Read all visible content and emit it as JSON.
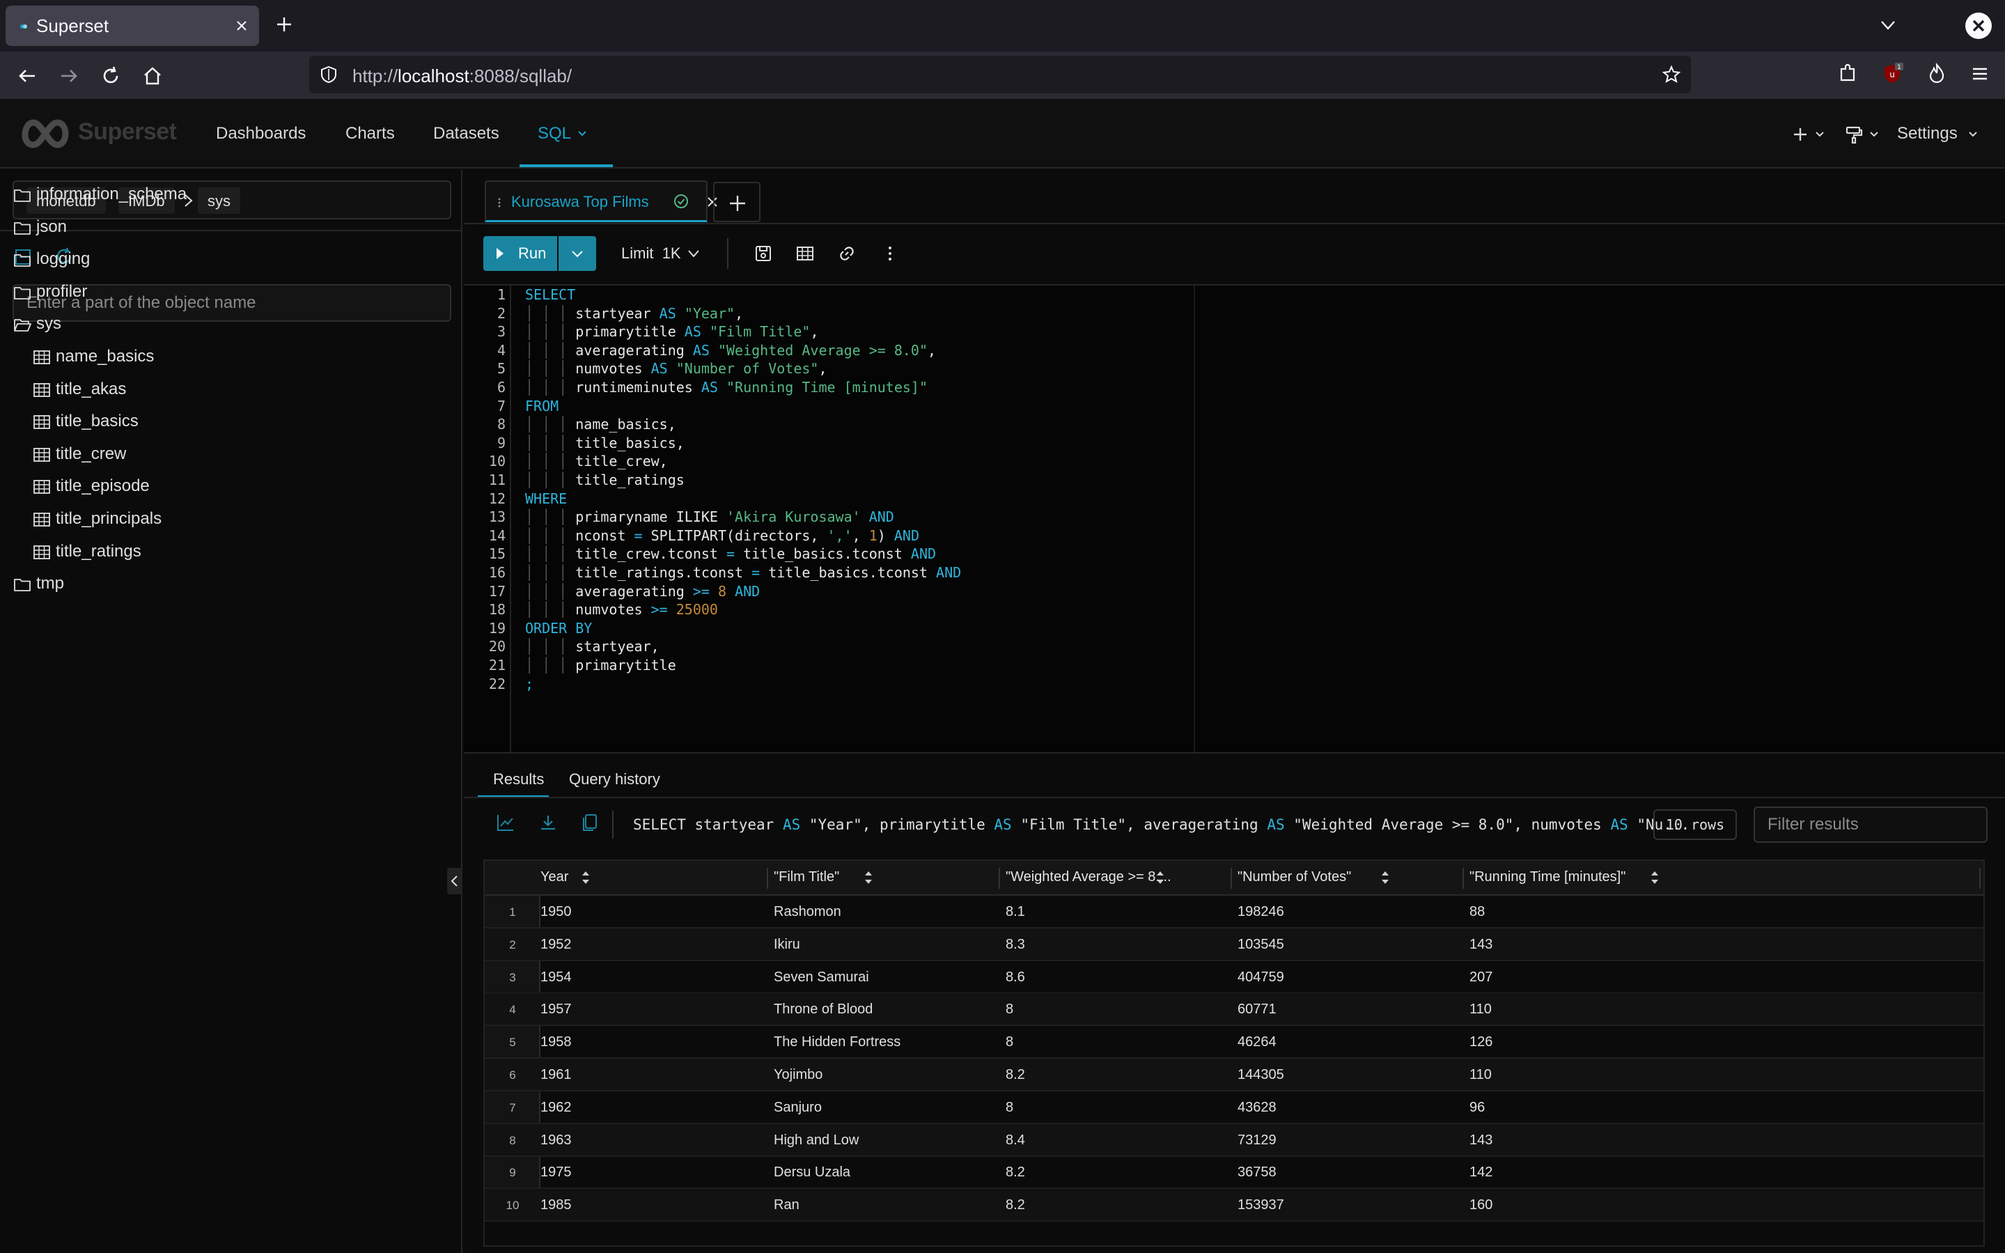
{
  "browser": {
    "tab_title": "Superset",
    "url_prefix": "http://",
    "url_host": "localhost",
    "url_rest": ":8088/sqllab/",
    "extension_badge": "1"
  },
  "header": {
    "logo": "Superset",
    "menu": [
      "Dashboards",
      "Charts",
      "Datasets",
      "SQL"
    ],
    "settings_label": "Settings"
  },
  "sidebar": {
    "database": "monetdb",
    "catalog": "IMDb",
    "schema": "sys",
    "search_placeholder": "Enter a part of the object name",
    "schemas": [
      {
        "name": "information_schema",
        "open": false
      },
      {
        "name": "json",
        "open": false
      },
      {
        "name": "logging",
        "open": false
      },
      {
        "name": "profiler",
        "open": false
      },
      {
        "name": "sys",
        "open": true
      }
    ],
    "tables": [
      "name_basics",
      "title_akas",
      "title_basics",
      "title_crew",
      "title_episode",
      "title_principals",
      "title_ratings"
    ],
    "after_schemas": [
      {
        "name": "tmp",
        "open": false
      }
    ]
  },
  "editor": {
    "tab_label": "Kurosawa Top Films",
    "run_label": "Run",
    "limit_label": "Limit",
    "limit_value": "1K",
    "lines": [
      [
        [
          "kw",
          "SELECT"
        ]
      ],
      [
        [
          "ind",
          ""
        ],
        [
          "t",
          "startyear "
        ],
        [
          "kw",
          "AS"
        ],
        [
          "t",
          " "
        ],
        [
          "str",
          "\"Year\""
        ],
        [
          "t",
          ","
        ]
      ],
      [
        [
          "ind",
          ""
        ],
        [
          "t",
          "primarytitle "
        ],
        [
          "kw",
          "AS"
        ],
        [
          "t",
          " "
        ],
        [
          "str",
          "\"Film Title\""
        ],
        [
          "t",
          ","
        ]
      ],
      [
        [
          "ind",
          ""
        ],
        [
          "t",
          "averagerating "
        ],
        [
          "kw",
          "AS"
        ],
        [
          "t",
          " "
        ],
        [
          "str",
          "\"Weighted Average >= 8.0\""
        ],
        [
          "t",
          ","
        ]
      ],
      [
        [
          "ind",
          ""
        ],
        [
          "t",
          "numvotes "
        ],
        [
          "kw",
          "AS"
        ],
        [
          "t",
          " "
        ],
        [
          "str",
          "\"Number of Votes\""
        ],
        [
          "t",
          ","
        ]
      ],
      [
        [
          "ind",
          ""
        ],
        [
          "t",
          "runtimeminutes "
        ],
        [
          "kw",
          "AS"
        ],
        [
          "t",
          " "
        ],
        [
          "str",
          "\"Running Time [minutes]\""
        ]
      ],
      [
        [
          "kw",
          "FROM"
        ]
      ],
      [
        [
          "ind",
          ""
        ],
        [
          "t",
          "name_basics,"
        ]
      ],
      [
        [
          "ind",
          ""
        ],
        [
          "t",
          "title_basics,"
        ]
      ],
      [
        [
          "ind",
          ""
        ],
        [
          "t",
          "title_crew,"
        ]
      ],
      [
        [
          "ind",
          ""
        ],
        [
          "t",
          "title_ratings"
        ]
      ],
      [
        [
          "kw",
          "WHERE"
        ]
      ],
      [
        [
          "ind",
          ""
        ],
        [
          "t",
          "primaryname ILIKE "
        ],
        [
          "str",
          "'Akira Kurosawa'"
        ],
        [
          "t",
          " "
        ],
        [
          "kw",
          "AND"
        ]
      ],
      [
        [
          "ind",
          ""
        ],
        [
          "t",
          "nconst "
        ],
        [
          "kw",
          "="
        ],
        [
          "t",
          " SPLITPART(directors, "
        ],
        [
          "str",
          "','"
        ],
        [
          "t",
          ", "
        ],
        [
          "num",
          "1"
        ],
        [
          "t",
          ") "
        ],
        [
          "kw",
          "AND"
        ]
      ],
      [
        [
          "ind",
          ""
        ],
        [
          "t",
          "title_crew.tconst "
        ],
        [
          "kw",
          "="
        ],
        [
          "t",
          " title_basics.tconst "
        ],
        [
          "kw",
          "AND"
        ]
      ],
      [
        [
          "ind",
          ""
        ],
        [
          "t",
          "title_ratings.tconst "
        ],
        [
          "kw",
          "="
        ],
        [
          "t",
          " title_basics.tconst "
        ],
        [
          "kw",
          "AND"
        ]
      ],
      [
        [
          "ind",
          ""
        ],
        [
          "t",
          "averagerating "
        ],
        [
          "kw",
          ">="
        ],
        [
          "t",
          " "
        ],
        [
          "num",
          "8"
        ],
        [
          "t",
          " "
        ],
        [
          "kw",
          "AND"
        ]
      ],
      [
        [
          "ind",
          ""
        ],
        [
          "t",
          "numvotes "
        ],
        [
          "kw",
          ">="
        ],
        [
          "t",
          " "
        ],
        [
          "num",
          "25000"
        ]
      ],
      [
        [
          "kw",
          "ORDER BY"
        ]
      ],
      [
        [
          "ind",
          ""
        ],
        [
          "t",
          "startyear,"
        ]
      ],
      [
        [
          "ind",
          ""
        ],
        [
          "t",
          "primarytitle"
        ]
      ],
      [
        [
          "kw",
          ";"
        ]
      ]
    ]
  },
  "results": {
    "tabs": [
      "Results",
      "Query history"
    ],
    "sql_preview": "SELECT startyear AS \"Year\", primarytitle AS \"Film Title\", averagerating AS \"Weighted Average >= 8.0\", numvotes AS \"Nu...",
    "row_count": "10 rows",
    "filter_placeholder": "Filter results",
    "columns": [
      "Year",
      "\"Film Title\"",
      "\"Weighted Average >= 8....",
      "\"Number of Votes\"",
      "\"Running Time [minutes]\""
    ],
    "rows": [
      [
        "1",
        "1950",
        "Rashomon",
        "8.1",
        "198246",
        "88"
      ],
      [
        "2",
        "1952",
        "Ikiru",
        "8.3",
        "103545",
        "143"
      ],
      [
        "3",
        "1954",
        "Seven Samurai",
        "8.6",
        "404759",
        "207"
      ],
      [
        "4",
        "1957",
        "Throne of Blood",
        "8",
        "60771",
        "110"
      ],
      [
        "5",
        "1958",
        "The Hidden Fortress",
        "8",
        "46264",
        "126"
      ],
      [
        "6",
        "1961",
        "Yojimbo",
        "8.2",
        "144305",
        "110"
      ],
      [
        "7",
        "1962",
        "Sanjuro",
        "8",
        "43628",
        "96"
      ],
      [
        "8",
        "1963",
        "High and Low",
        "8.4",
        "73129",
        "143"
      ],
      [
        "9",
        "1975",
        "Dersu Uzala",
        "8.2",
        "36758",
        "142"
      ],
      [
        "10",
        "1985",
        "Ran",
        "8.2",
        "153937",
        "160"
      ]
    ]
  },
  "colors": {
    "accent": "#1aa3c8",
    "run_button": "#1a85a0",
    "keyword": "#2fb5dc",
    "string": "#57b886",
    "number": "#c48a3a"
  }
}
